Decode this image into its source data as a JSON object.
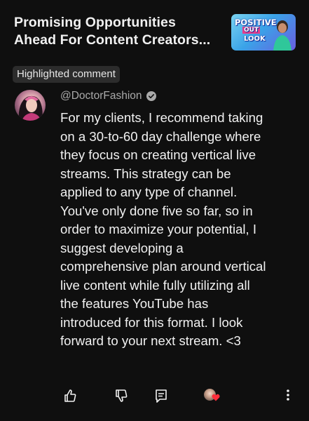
{
  "video": {
    "title_line1": "Promising Opportunities",
    "title_line2": "Ahead For Content Creators...",
    "thumbnail": {
      "word1": "POSITIVE",
      "word2": "OUT",
      "word3": "LOOK"
    }
  },
  "highlight_badge": "Highlighted comment",
  "comment": {
    "author": "@DoctorFashion",
    "verified": true,
    "text": "For my clients, I recommend taking\non a 30-to-60 day challenge where\nthey focus on creating vertical live\nstreams. This strategy can be\napplied to any type of channel.\nYou've only done five so far, so in\norder to maximize your potential, I\nsuggest developing a\ncomprehensive plan around vertical\nlive content while fully utilizing all\nthe features YouTube has\nintroduced for this format. I look\nforward to your next stream. <3"
  },
  "actions": {
    "icons": [
      "thumbs-up-icon",
      "thumbs-down-icon",
      "reply-icon",
      "creator-heart-icon",
      "more-vert-icon"
    ]
  },
  "colors": {
    "background": "#0f0f0f",
    "text": "#f1f1f1",
    "secondary_text": "#aaaaaa",
    "badge_bg": "#2c2c2c",
    "heart": "#ff2d3a"
  }
}
